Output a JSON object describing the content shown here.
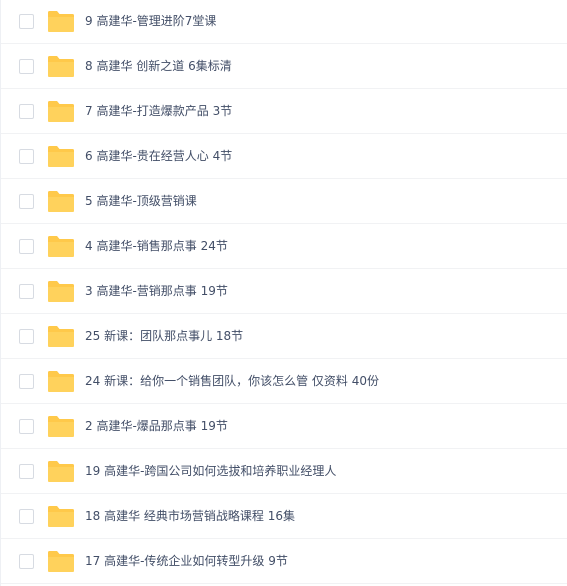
{
  "file_list": {
    "folder_icon": "folder-icon",
    "folder_color": "#ffc94a",
    "items": [
      {
        "name": "9 高建华-管理进阶7堂课"
      },
      {
        "name": "8 高建华 创新之道 6集标清"
      },
      {
        "name": "7 高建华-打造爆款产品 3节"
      },
      {
        "name": "6 高建华-贵在经营人心 4节"
      },
      {
        "name": "5 高建华-顶级营销课"
      },
      {
        "name": "4 高建华-销售那点事 24节"
      },
      {
        "name": "3 高建华-营销那点事 19节"
      },
      {
        "name": "25 新课：团队那点事儿 18节"
      },
      {
        "name": "24 新课：给你一个销售团队，你该怎么管 仅资料 40份"
      },
      {
        "name": "2 高建华-爆品那点事 19节"
      },
      {
        "name": "19 高建华-跨国公司如何选拔和培养职业经理人"
      },
      {
        "name": "18 高建华 经典市场营销战略课程 16集"
      },
      {
        "name": "17 高建华-传统企业如何转型升级 9节"
      }
    ]
  }
}
